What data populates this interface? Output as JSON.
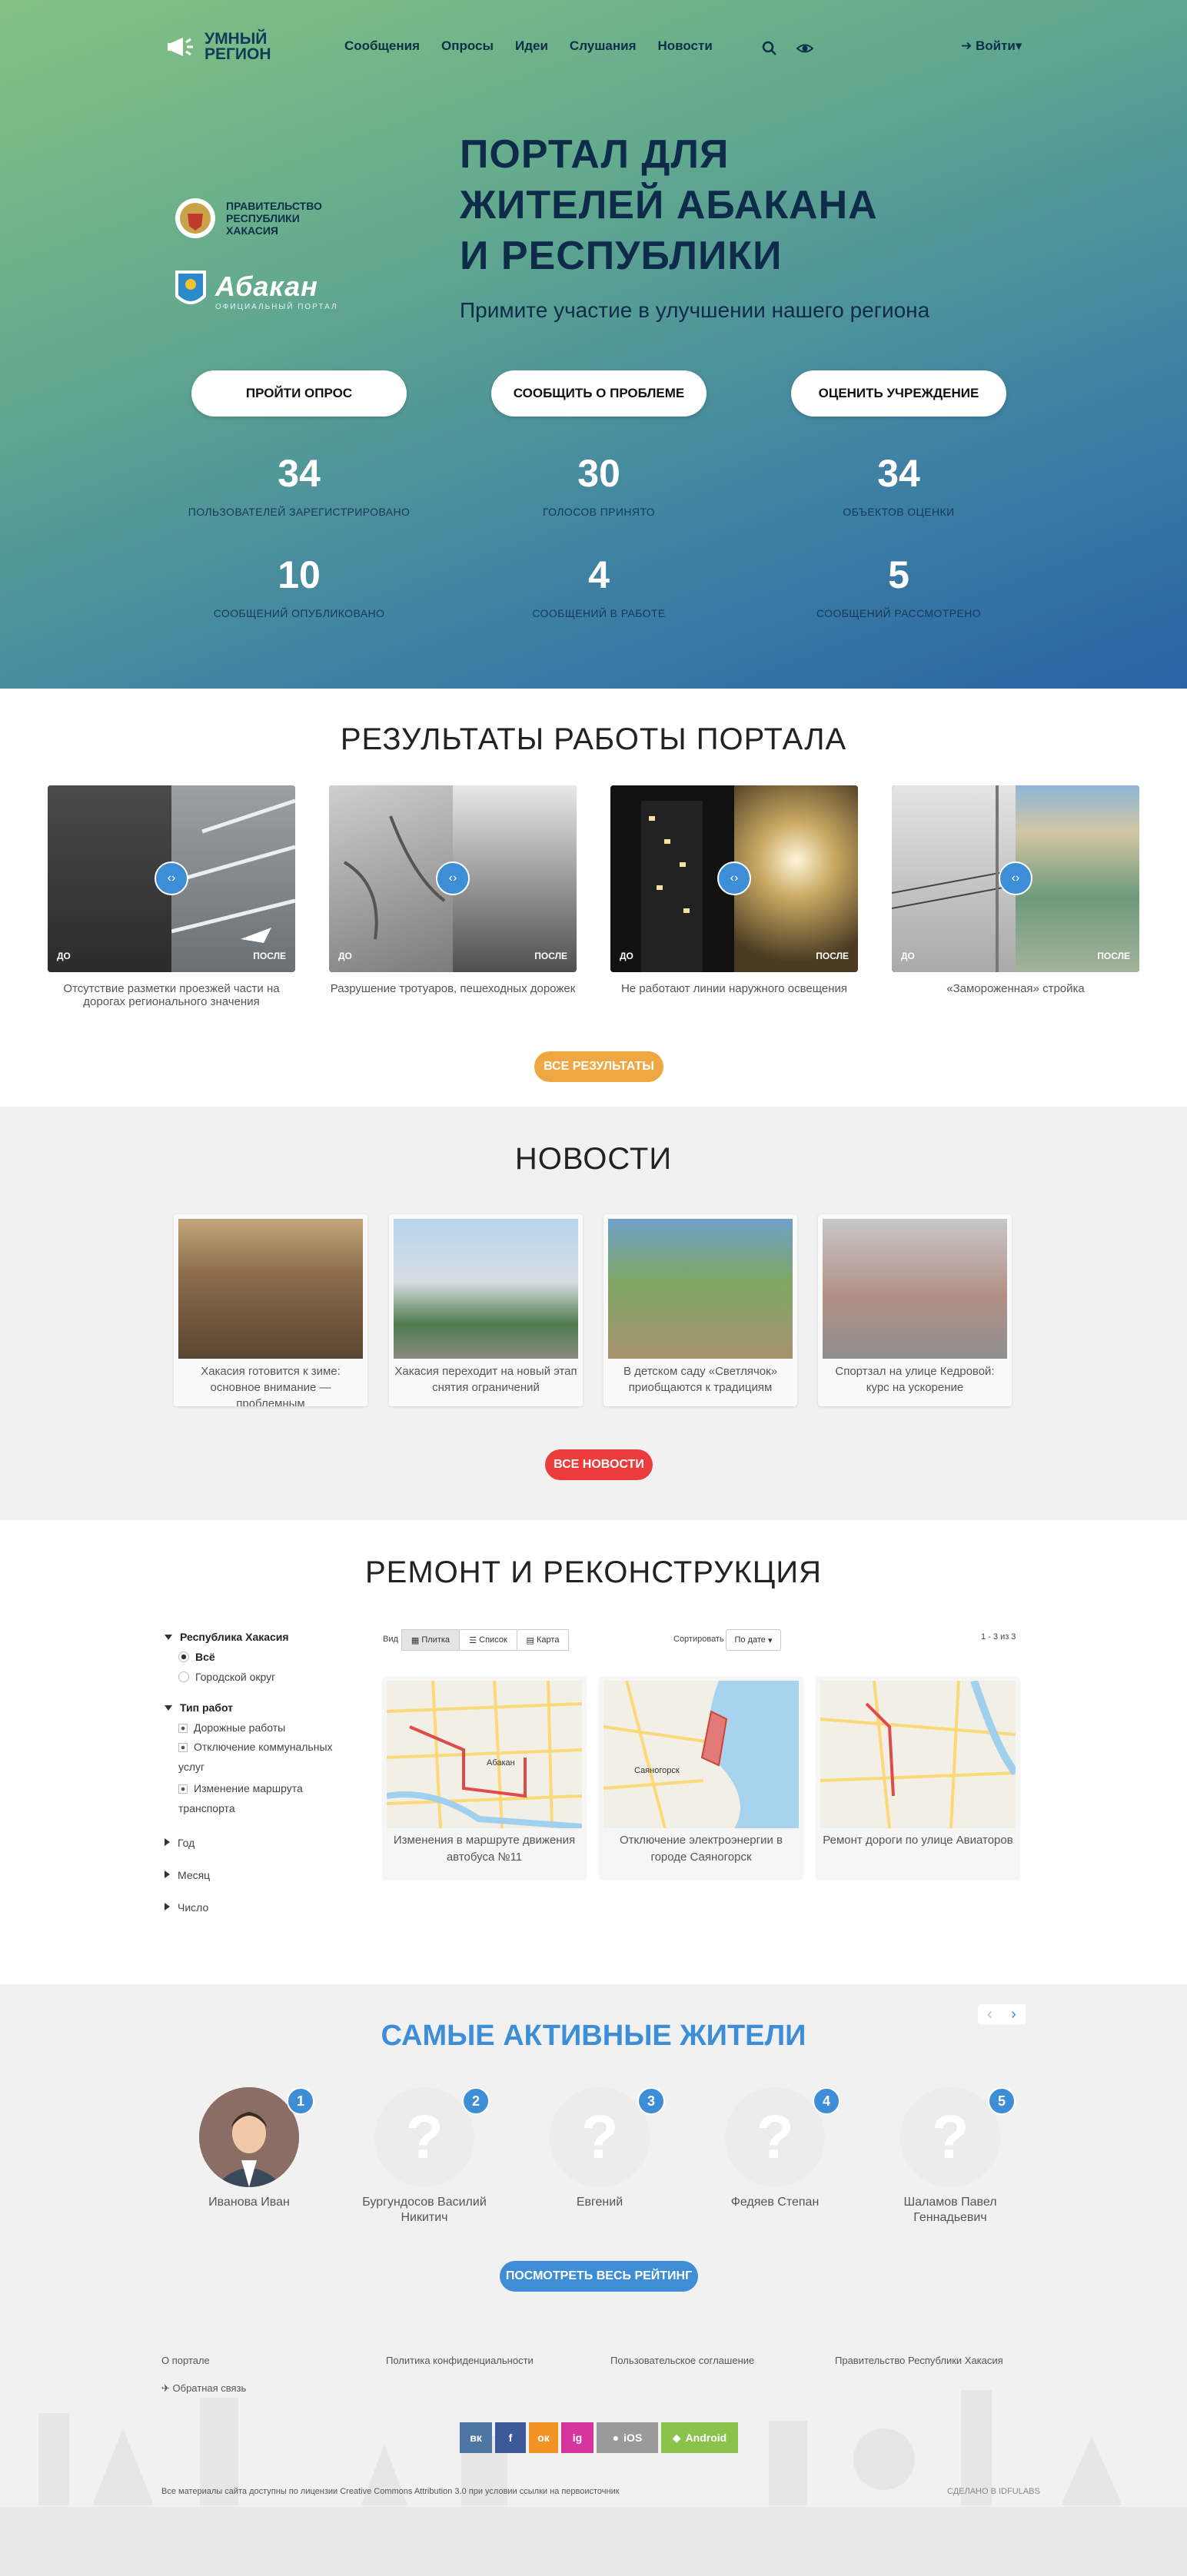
{
  "header": {
    "logo_line1": "УМНЫЙ",
    "logo_line2": "РЕГИОН",
    "nav": [
      "Сообщения",
      "Опросы",
      "Идеи",
      "Слушания",
      "Новости"
    ],
    "login": "Войти"
  },
  "hero": {
    "gov_text": "ПРАВИТЕЛЬСТВО РЕСПУБЛИКИ ХАКАСИЯ",
    "abakan_name": "Абакан",
    "abakan_sub": "ОФИЦИАЛЬНЫЙ ПОРТАЛ",
    "title_lines": [
      "ПОРТАЛ ДЛЯ",
      "ЖИТЕЛЕЙ АБАКАНА",
      "И РЕСПУБЛИКИ"
    ],
    "subtitle": "Примите участие в улучшении нашего региона",
    "buttons": [
      "ПРОЙТИ ОПРОС",
      "СООБЩИТЬ О ПРОБЛЕМЕ",
      "ОЦЕНИТЬ УЧРЕЖДЕНИЕ"
    ],
    "stats": [
      {
        "value": "34",
        "label": "ПОЛЬЗОВАТЕЛЕЙ ЗАРЕГИСТРИРОВАНО"
      },
      {
        "value": "30",
        "label": "ГОЛОСОВ ПРИНЯТО"
      },
      {
        "value": "34",
        "label": "ОБЪЕКТОВ ОЦЕНКИ"
      },
      {
        "value": "10",
        "label": "СООБЩЕНИЙ ОПУБЛИКОВАНО"
      },
      {
        "value": "4",
        "label": "СООБЩЕНИЙ В РАБОТЕ"
      },
      {
        "value": "5",
        "label": "СООБЩЕНИЙ РАССМОТРЕНО"
      }
    ]
  },
  "results": {
    "title": "РЕЗУЛЬТАТЫ РАБОТЫ ПОРТАЛА",
    "before_label": "ДО",
    "after_label": "ПОСЛЕ",
    "items": [
      "Отсутствие разметки проезжей части на дорогах регионального значения",
      "Разрушение тротуаров, пешеходных дорожек",
      "Не работают линии наружного освещения",
      "«Замороженная» стройка"
    ],
    "all_button": "ВСЕ РЕЗУЛЬТАТЫ"
  },
  "news": {
    "title": "НОВОСТИ",
    "items": [
      "Хакасия готовится к зиме: основное внимание — проблемным",
      "Хакасия переходит на новый этап снятия ограничений",
      "В детском саду «Светлячок» приобщаются к традициям",
      "Спортзал на улице Кедровой: курс на ускорение"
    ],
    "all_button": "ВСЕ НОВОСТИ"
  },
  "repair": {
    "title": "РЕМОНТ И РЕКОНСТРУКЦИЯ",
    "filters": {
      "region_title": "Республика Хакасия",
      "region_options": [
        "Всё",
        "Городской округ"
      ],
      "type_title": "Тип работ",
      "type_options": [
        "Дорожные работы",
        "Отключение коммунальных услуг",
        "Изменение маршрута транспорта"
      ],
      "collapsed": [
        "Год",
        "Месяц",
        "Число"
      ]
    },
    "view_label": "Вид",
    "views": [
      "Плитка",
      "Список",
      "Карта"
    ],
    "sort_label": "Сортировать",
    "sort_value": "По дате",
    "count": "1 - 3 из 3",
    "map_label": "Абакан",
    "map_label2": "Саяногорск",
    "items": [
      "Изменения в маршруте движения автобуса №11",
      "Отключение электроэнергии в городе Саяногорск",
      "Ремонт дороги по улице Авиаторов"
    ]
  },
  "active": {
    "title": "САМЫЕ АКТИВНЫЕ ЖИТЕЛИ",
    "people": [
      {
        "rank": "1",
        "name": "Иванова Иван"
      },
      {
        "rank": "2",
        "name": "Бургундосов Василий Никитич"
      },
      {
        "rank": "3",
        "name": "Евгений"
      },
      {
        "rank": "4",
        "name": "Федяев Степан"
      },
      {
        "rank": "5",
        "name": "Шаламов Павел Геннадьевич"
      }
    ],
    "placeholder": "?",
    "rating_button": "ПОСМОТРЕТЬ ВЕСЬ РЕЙТИНГ"
  },
  "footer": {
    "links": [
      "О портале",
      "Политика конфиденциальности",
      "Пользовательское соглашение",
      "Правительство Республики Хакасия"
    ],
    "feedback": "Обратная связь",
    "social": [
      "вк",
      "f",
      "ок",
      "ig",
      "iOS",
      "Android"
    ],
    "license": "Все материалы сайта доступны по лицензии Creative Commons Attribution 3.0 при условии ссылки на первоисточник",
    "made": "СДЕЛАНО В IDFULABS"
  },
  "colors": {
    "accent_blue": "#3d8ed7",
    "orange": "#efa743",
    "red": "#ed3c3c"
  }
}
